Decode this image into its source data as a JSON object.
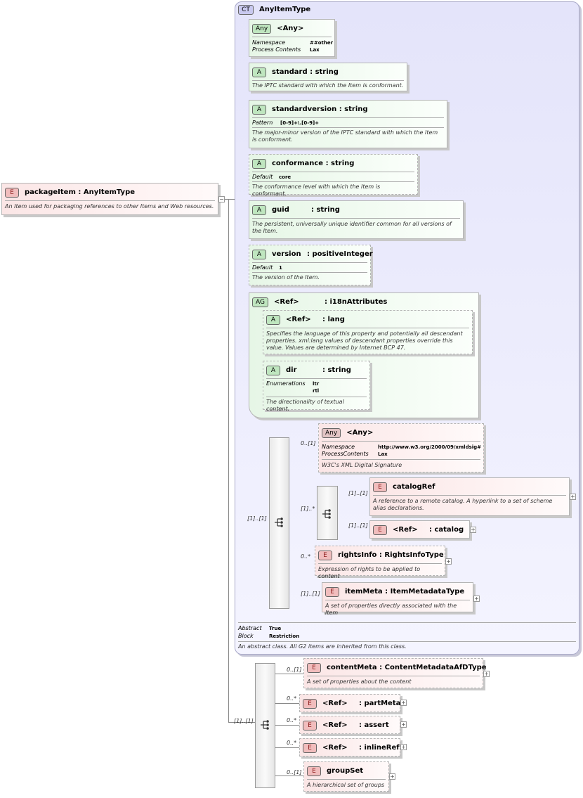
{
  "root": {
    "title": "packageItem : AnyItemType",
    "badge": "E",
    "doc": "An Item used for packaging references to other Items and Web resources."
  },
  "complex_type": {
    "badge": "CT",
    "title": "AnyItemType",
    "props": [
      {
        "k": "Abstract",
        "v": "True"
      },
      {
        "k": "Block",
        "v": "Restriction"
      }
    ],
    "doc": "An abstract class. All G2 items are inherited from this class."
  },
  "any_attr": {
    "badge": "Any",
    "title": "<Any>",
    "props": [
      {
        "k": "Namespace",
        "v": "##other"
      },
      {
        "k": "Process Contents",
        "v": "Lax"
      }
    ]
  },
  "attr_standard": {
    "badge": "A",
    "name": "standard",
    "type": ": string",
    "doc": "The IPTC standard with which the Item is conformant."
  },
  "attr_standardversion": {
    "badge": "A",
    "name": "standardversion",
    "type": ": string",
    "props": [
      {
        "k": "Pattern",
        "v": "[0-9]+\\.[0-9]+"
      }
    ],
    "doc": "The major-minor version of the IPTC standard with which the Item is conformant."
  },
  "attr_conformance": {
    "badge": "A",
    "name": "conformance",
    "type": ": string",
    "props": [
      {
        "k": "Default",
        "v": "core"
      }
    ],
    "doc": "The conformance level with which the Item is conformant."
  },
  "attr_guid": {
    "badge": "A",
    "name": "guid",
    "type": ": string",
    "doc": "The persistent, universally unique identifier common for all versions of the Item."
  },
  "attr_version": {
    "badge": "A",
    "name": "version",
    "type": ": positiveInteger",
    "props": [
      {
        "k": "Default",
        "v": "1"
      }
    ],
    "doc": "The version of the Item."
  },
  "attr_group": {
    "badge": "AG",
    "name": "<Ref>",
    "type": ": i18nAttributes"
  },
  "attr_lang": {
    "badge": "A",
    "name": "<Ref>",
    "type": ": lang",
    "doc": "Specifies the language of this property and potentially all descendant properties. xml:lang values of descendant properties override this value. Values are determined by Internet BCP 47."
  },
  "attr_dir": {
    "badge": "A",
    "name": "dir",
    "type": ": string",
    "props": [
      {
        "k": "Enumerations",
        "v": "ltr"
      },
      {
        "k": "",
        "v": "rtl"
      }
    ],
    "doc": "The directionality of textual content."
  },
  "any_elem": {
    "badge": "Any",
    "title": "<Any>",
    "props": [
      {
        "k": "Namespace",
        "v": "http://www.w3.org/2000/09/xmldsig#"
      },
      {
        "k": "ProcessContents",
        "v": "Lax"
      }
    ],
    "doc": "W3C's XML Digital Signature"
  },
  "catalogRef": {
    "badge": "E",
    "name": "catalogRef",
    "doc": "A reference to a remote catalog. A hyperlink to a set of scheme alias declarations."
  },
  "catalog": {
    "badge": "E",
    "name": "<Ref>",
    "type": ": catalog"
  },
  "rightsInfo": {
    "badge": "E",
    "name": "rightsInfo",
    "type": ": RightsInfoType",
    "doc": "Expression of rights to be applied to content"
  },
  "itemMeta": {
    "badge": "E",
    "name": "itemMeta",
    "type": ": ItemMetadataType",
    "doc": "A set of properties directly associated with the Item"
  },
  "contentMeta": {
    "badge": "E",
    "name": "contentMeta",
    "type": ": ContentMetadataAfDType",
    "doc": "A set of properties about the content"
  },
  "partMeta": {
    "badge": "E",
    "name": "<Ref>",
    "type": ": partMeta"
  },
  "assert": {
    "badge": "E",
    "name": "<Ref>",
    "type": ": assert"
  },
  "inlineRef": {
    "badge": "E",
    "name": "<Ref>",
    "type": ": inlineRef"
  },
  "groupSet": {
    "badge": "E",
    "name": "groupSet",
    "doc": "A hierarchical set of groups"
  },
  "cards": {
    "any_elem": "0..[1]",
    "choice_inner": "[1]..*",
    "catalogRef": "[1]..[1]",
    "catalog": "[1]..[1]",
    "rightsInfo": "0..*",
    "itemMeta": "[1]..[1]",
    "seq1": "[1]..[1]",
    "contentMeta": "0..[1]",
    "partMeta": "0..*",
    "assert": "0..*",
    "inlineRef": "0..*",
    "groupSet": "0..[1]",
    "seq2": "[1]..[1]"
  },
  "expand_glyph": "+",
  "collapse_glyph": "−",
  "icons": {
    "sequence": "sequence-icon",
    "choice": "choice-icon"
  }
}
